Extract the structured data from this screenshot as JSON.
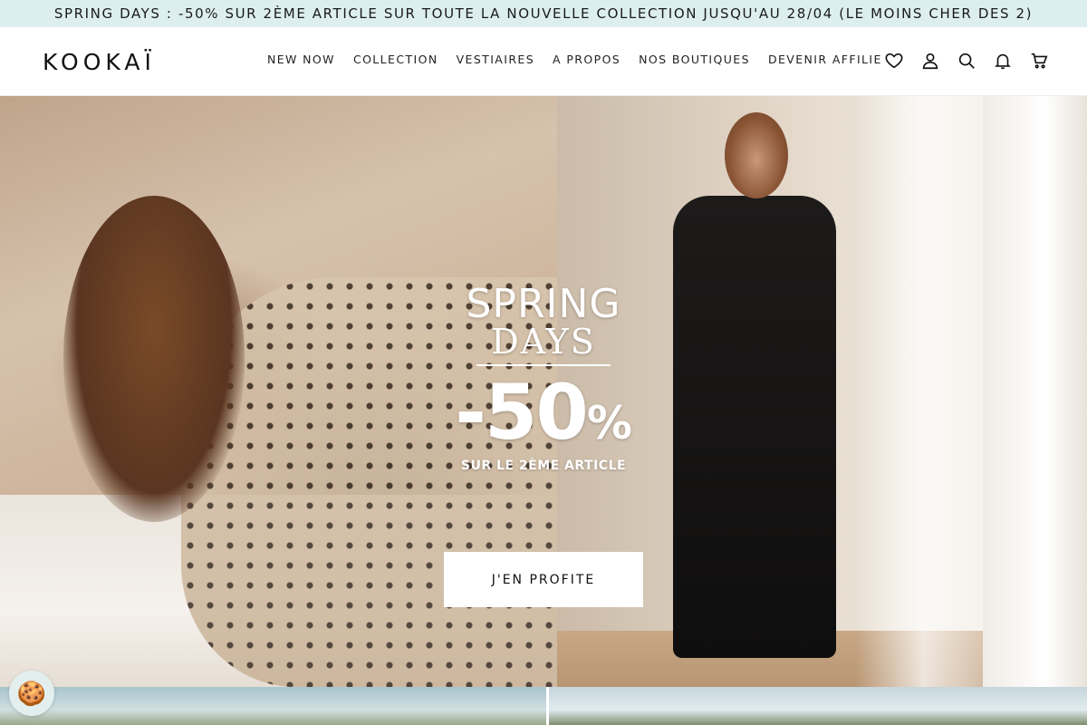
{
  "announcement": "SPRING DAYS : -50% SUR 2ÈME ARTICLE SUR TOUTE LA NOUVELLE COLLECTION JUSQU'AU 28/04 (LE MOINS CHER DES 2)",
  "header": {
    "logo": "KOOKAÏ",
    "nav": [
      "NEW NOW",
      "COLLECTION",
      "VESTIAIRES",
      "A PROPOS",
      "NOS BOUTIQUES",
      "DEVENIR AFFILIE"
    ],
    "icons": [
      "heart-icon",
      "account-icon",
      "search-icon",
      "bell-icon",
      "cart-icon"
    ]
  },
  "hero": {
    "promo_line1": "SPRING",
    "promo_line2": "DAYS",
    "promo_discount": "-50",
    "promo_percent": "%",
    "promo_subtitle": "SUR LE 2ÈME ARTICLE",
    "cta_label": "J'EN PROFITE"
  },
  "colors": {
    "announcement_bg": "#dcefee",
    "header_bg": "#ffffff",
    "cta_bg": "#ffffff"
  },
  "cookie_icon": "cookie-icon"
}
